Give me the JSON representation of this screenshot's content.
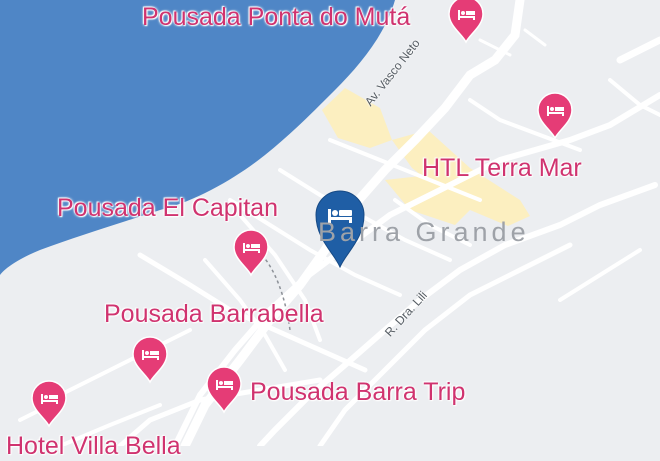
{
  "map": {
    "town_label": "Barra Grande",
    "streets": [
      {
        "id": "av-vasco-neto",
        "label": "Av. Vasco Neto"
      },
      {
        "id": "r-dra-lili",
        "label": "R. Dra. Lili"
      }
    ],
    "places": [
      {
        "id": "pousada-ponta-do-muta",
        "label": "Pousada Ponta do Mutá",
        "icon": "hotel-icon"
      },
      {
        "id": "htl-terra-mar",
        "label": "HTL Terra Mar",
        "icon": "hotel-icon"
      },
      {
        "id": "pousada-el-capitan",
        "label": "Pousada El Capitan",
        "icon": "hotel-icon"
      },
      {
        "id": "pousada-barrabella",
        "label": "Pousada Barrabella",
        "icon": "hotel-icon"
      },
      {
        "id": "pousada-barra-trip",
        "label": "Pousada Barra Trip",
        "icon": "hotel-icon"
      },
      {
        "id": "hotel-villa-bella",
        "label": "Hotel Villa Bella",
        "icon": "hotel-icon"
      }
    ],
    "selected_marker": {
      "icon": "hotel-icon",
      "color": "#1f5ea5"
    },
    "colors": {
      "water": "#4f86c6",
      "land": "#eceef1",
      "road": "#ffffff",
      "highlight": "#fcefc0",
      "poi_text": "#d0336f",
      "poi_pin": "#e53c76"
    }
  }
}
